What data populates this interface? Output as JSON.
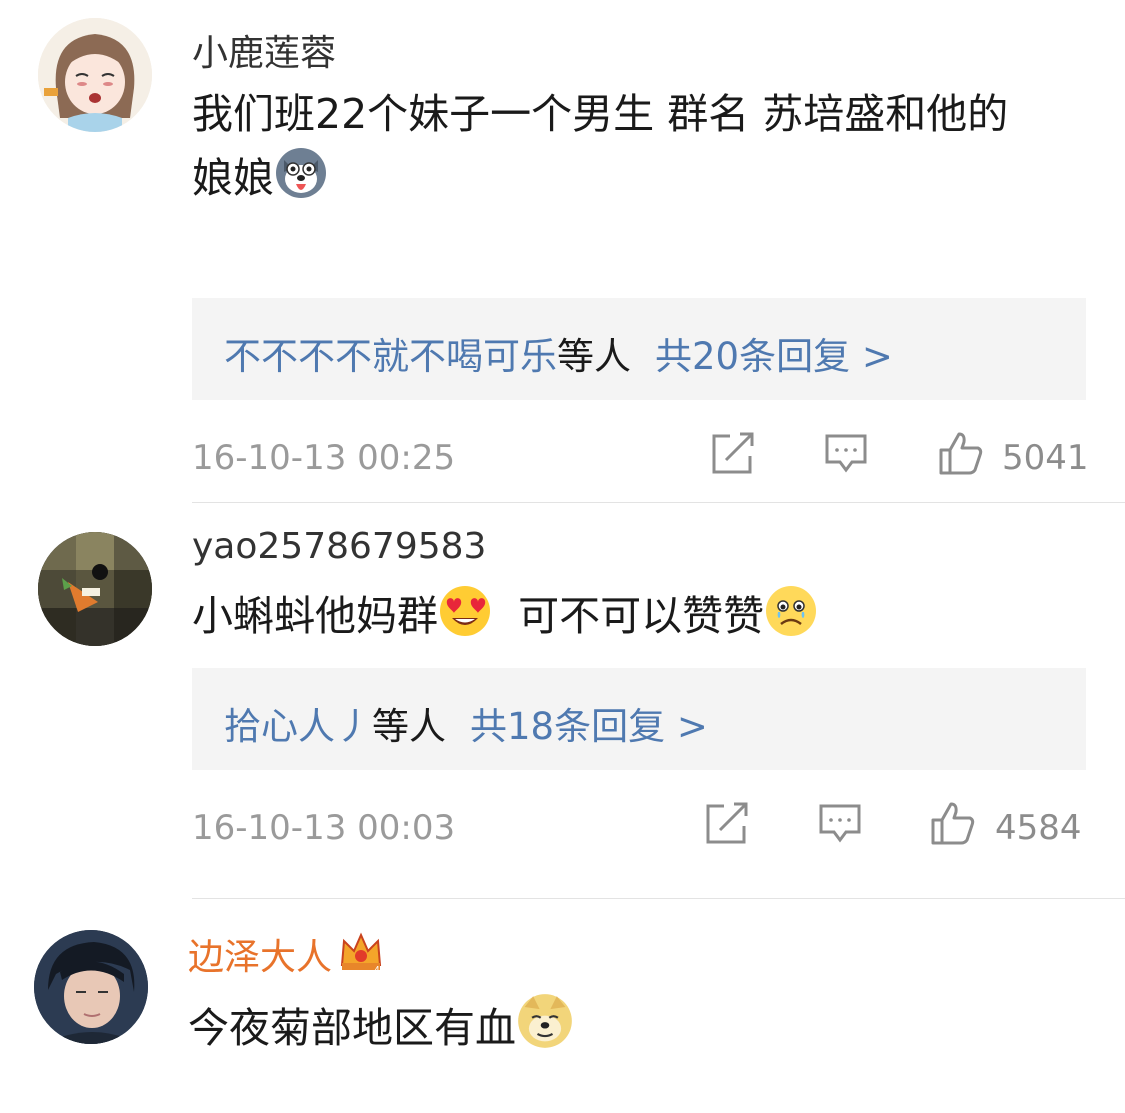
{
  "comments": [
    {
      "username": "小鹿莲蓉",
      "text_line1": "我们班22个妹子一个男生 群名 苏培盛和他的",
      "text_line2": "娘娘",
      "emoji_after": "husky-emoji",
      "reply_names": "不不不不就不喝可乐",
      "reply_etc": "等人",
      "reply_count": "共20条回复 >",
      "timestamp": "16-10-13 00:25",
      "likes": "5041"
    },
    {
      "username": "yao2578679583",
      "text_part1": "小蝌蚪他妈群",
      "text_part2": "  可不可以赞赞",
      "emoji_mid": "heart-eyes-emoji",
      "emoji_end": "teary-sad-emoji",
      "reply_names": "拾心人丿",
      "reply_etc": "等人",
      "reply_count": "共18条回复 >",
      "timestamp": "16-10-13 00:03",
      "likes": "4584"
    },
    {
      "username": "边泽大人",
      "vip_badge": "crown-icon",
      "text": "今夜菊部地区有血",
      "emoji_end": "doge-emoji"
    }
  ],
  "colors": {
    "link": "#4f79b0",
    "vip_name": "#e8732b",
    "meta": "#9a9a9a",
    "reply_bg": "#f4f4f4"
  }
}
